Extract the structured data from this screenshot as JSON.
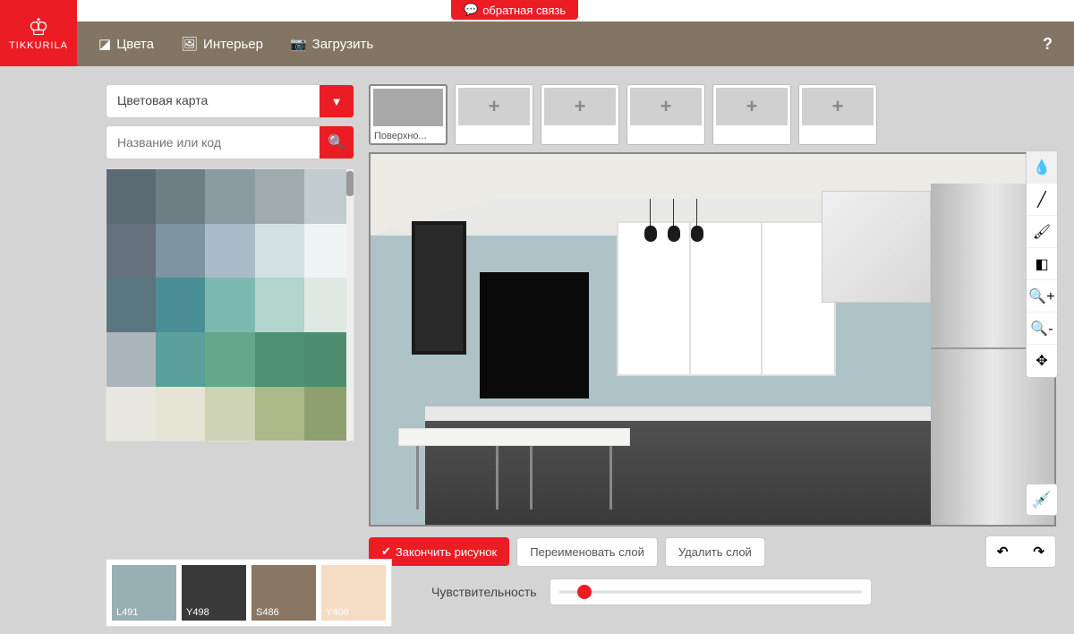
{
  "feedback_label": "обратная связь",
  "brand": "TIKKURILA",
  "nav": {
    "colors": "Цвета",
    "interior": "Интерьер",
    "upload": "Загрузить"
  },
  "help": "?",
  "dropdown_label": "Цветовая карта",
  "search_placeholder": "Название или код",
  "palette": [
    "#5b6a73",
    "#6f7d85",
    "#8b9aa0",
    "#9fabae",
    "#c2cbce",
    "#64707b",
    "#7d95a2",
    "#a8bdc7",
    "#d2e0e3",
    "#eff3f3",
    "#5a7680",
    "#4a8e95",
    "#7db9b3",
    "#b2d5ce",
    "#dfe8e2",
    "#aab5bc",
    "#5aa09a",
    "#64a88a",
    "#4e9073",
    "#4f8d71",
    "#e8e8e0",
    "#e6e5d5",
    "#cfd3b5",
    "#aab987",
    "#8fa070"
  ],
  "selected": [
    {
      "code": "L491",
      "hex": "#98afb4"
    },
    {
      "code": "Y498",
      "hex": "#393939"
    },
    {
      "code": "S486",
      "hex": "#8a7763"
    },
    {
      "code": "Y406",
      "hex": "#f4dcc5"
    }
  ],
  "surface_tab_label": "Поверхно...",
  "actions": {
    "finish": "Закончить рисунок",
    "rename": "Переименовать слой",
    "delete": "Удалить слой"
  },
  "sensitivity_label": "Чувствительность",
  "tools": [
    "fill",
    "line",
    "brush",
    "eraser",
    "zoom-in",
    "zoom-out",
    "move"
  ]
}
